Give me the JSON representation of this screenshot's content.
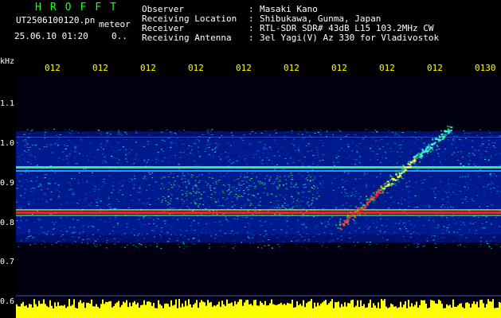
{
  "header": {
    "app_title": "HROFFT",
    "filename": "UT2506100120.pn",
    "tag": "meteor",
    "datetime": "25.06.10 01:20",
    "count": "0..",
    "info": [
      {
        "label": "Observer",
        "value": "Masaki Kano"
      },
      {
        "label": "Receiving Location",
        "value": "Shibukawa, Gunma, Japan"
      },
      {
        "label": "Receiver",
        "value": "RTL-SDR SDR# 43dB L15 103.2MHz CW"
      },
      {
        "label": "Receiving Antenna",
        "value": "3el Yagi(V) Az 330 for Vladivostok"
      }
    ]
  },
  "axis": {
    "y_unit": "kHz",
    "y_ticks": [
      "1.1",
      "1.0",
      "0.9",
      "0.8",
      "0.7",
      "0.6"
    ],
    "x_ticks": [
      "012",
      "012",
      "012",
      "012",
      "012",
      "012",
      "012",
      "012",
      "012",
      "0130"
    ]
  },
  "colors": {
    "background": "#000000",
    "plot_bg": "#000020",
    "title": "#19ff19",
    "tick_labels": "#ffff00",
    "text": "#ffffff",
    "signal_bar": "#ffff00"
  }
}
